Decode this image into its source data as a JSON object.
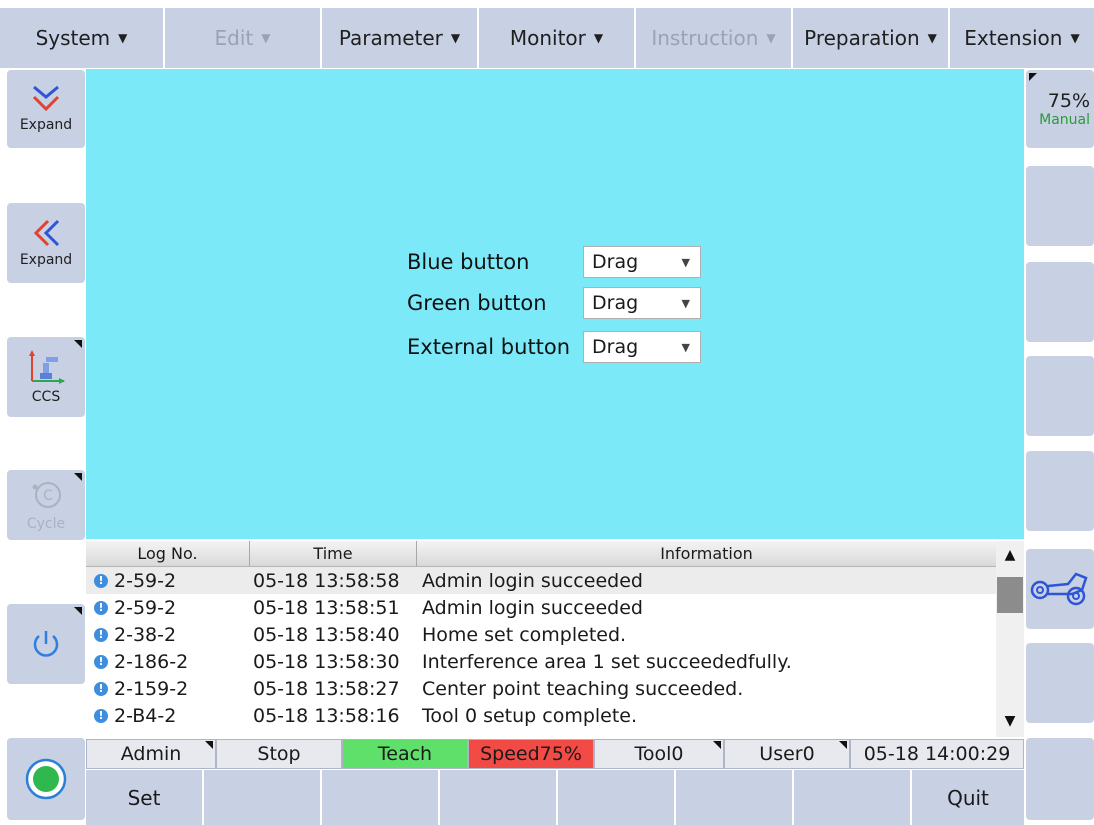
{
  "menu": [
    {
      "label": "System",
      "disabled": false
    },
    {
      "label": "Edit",
      "disabled": true
    },
    {
      "label": "Parameter",
      "disabled": false
    },
    {
      "label": "Monitor",
      "disabled": false
    },
    {
      "label": "Instruction",
      "disabled": true
    },
    {
      "label": "Preparation",
      "disabled": false
    },
    {
      "label": "Extension",
      "disabled": false
    }
  ],
  "left_panel": {
    "expand_down_label": "Expand",
    "expand_left_label": "Expand",
    "ccs_label": "CCS",
    "cycle_label": "Cycle"
  },
  "right_panel": {
    "speed": "75%",
    "mode": "Manual"
  },
  "form": {
    "rows": [
      {
        "label": "Blue button",
        "value": "Drag"
      },
      {
        "label": "Green button",
        "value": "Drag"
      },
      {
        "label": "External button",
        "value": "Drag"
      }
    ]
  },
  "log": {
    "headers": [
      "Log No.",
      "Time",
      "Information"
    ],
    "rows": [
      {
        "no": "2-59-2",
        "time": "05-18 13:58:58",
        "info": "Admin  login succeeded"
      },
      {
        "no": "2-59-2",
        "time": "05-18 13:58:51",
        "info": "Admin  login succeeded"
      },
      {
        "no": "2-38-2",
        "time": "05-18 13:58:40",
        "info": "Home set completed."
      },
      {
        "no": "2-186-2",
        "time": "05-18 13:58:30",
        "info": "Interference area 1 set succeededfully."
      },
      {
        "no": "2-159-2",
        "time": "05-18 13:58:27",
        "info": "Center point teaching succeeded."
      },
      {
        "no": "2-B4-2",
        "time": "05-18 13:58:16",
        "info": "Tool 0 setup complete."
      }
    ]
  },
  "status": {
    "user": "Admin",
    "state": "Stop",
    "mode": "Teach",
    "speed": "Speed75%",
    "tool": "Tool0",
    "user_frame": "User0",
    "datetime": "05-18 14:00:29"
  },
  "colors": {
    "teach_bg": "#5ee06a",
    "speed_bg": "#f24a45",
    "workspace_bg": "#7ce9f9",
    "button_bg": "#c8d0e3"
  },
  "bottom": {
    "set_label": "Set",
    "quit_label": "Quit"
  }
}
